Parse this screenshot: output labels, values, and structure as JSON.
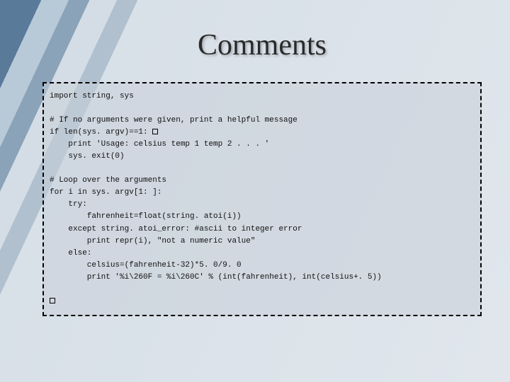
{
  "slide": {
    "title": "Comments",
    "code": {
      "l01": "import string, sys",
      "l02": "",
      "l03": "# If no arguments were given, print a helpful message",
      "l04a": "if len(sys. argv)==1: ",
      "l05": "    print 'Usage: celsius temp 1 temp 2 . . . '",
      "l06": "    sys. exit(0)",
      "l07": "",
      "l08": "# Loop over the arguments",
      "l09": "for i in sys. argv[1: ]:",
      "l10": "    try:",
      "l11": "        fahrenheit=float(string. atoi(i))",
      "l12": "    except string. atoi_error: #ascii to integer error",
      "l13": "        print repr(i), \"not a numeric value\"",
      "l14": "    else:",
      "l15": "        celsius=(fahrenheit-32)*5. 0/9. 0",
      "l16": "        print '%i\\260F = %i\\260C' % (int(fahrenheit), int(celsius+. 5))",
      "l17": ""
    }
  }
}
